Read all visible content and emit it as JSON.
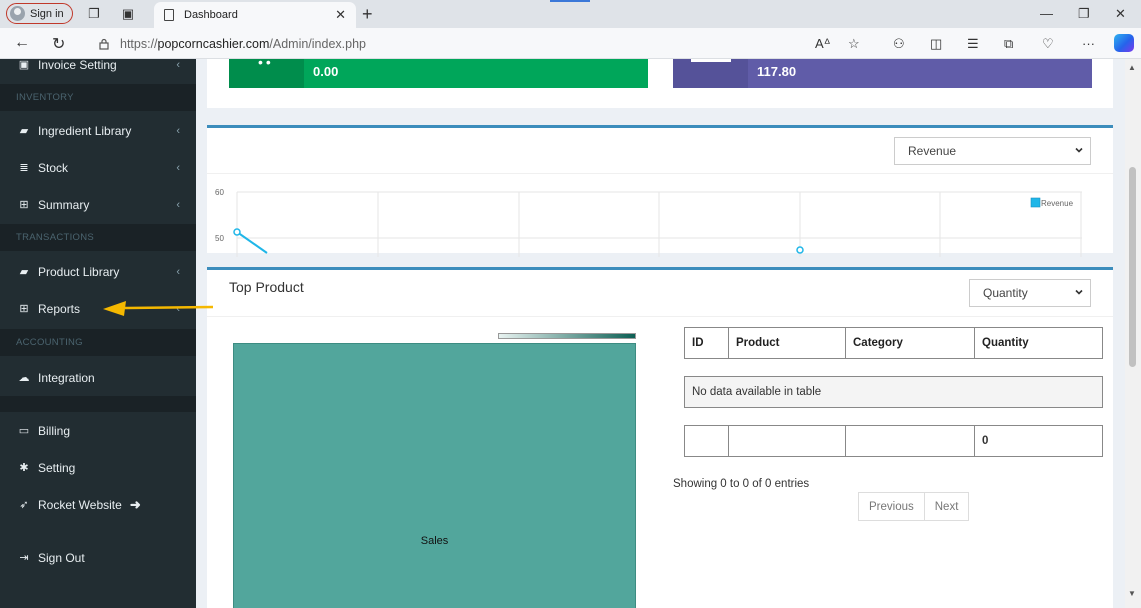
{
  "browser": {
    "signin_label": "Sign in",
    "tab_title": "Dashboard",
    "url_prefix": "https://",
    "url_domain": "popcorncashier.com",
    "url_path": "/Admin/index.php"
  },
  "sidebar": {
    "items": [
      {
        "id": "invoice-setting",
        "label": "Invoice Setting",
        "icon": "invoice-icon",
        "chevron": true
      },
      {
        "id": "ingredient-library",
        "label": "Ingredient Library",
        "icon": "book-icon",
        "chevron": true
      },
      {
        "id": "stock",
        "label": "Stock",
        "icon": "database-icon",
        "chevron": true
      },
      {
        "id": "summary",
        "label": "Summary",
        "icon": "table-icon",
        "chevron": true
      },
      {
        "id": "product-library",
        "label": "Product Library",
        "icon": "book-icon",
        "chevron": true
      },
      {
        "id": "reports",
        "label": "Reports",
        "icon": "table-icon",
        "chevron": true
      },
      {
        "id": "integration",
        "label": "Integration",
        "icon": "cloud-icon",
        "chevron": false
      },
      {
        "id": "billing",
        "label": "Billing",
        "icon": "credit-card-icon",
        "chevron": false
      },
      {
        "id": "setting",
        "label": "Setting",
        "icon": "gear-icon",
        "chevron": false
      },
      {
        "id": "rocket-website",
        "label": "Rocket Website",
        "icon": "rocket-icon",
        "chevron": false,
        "suffix_icon": "arrow-right-icon"
      },
      {
        "id": "sign-out",
        "label": "Sign Out",
        "icon": "sign-out-icon",
        "chevron": false
      }
    ],
    "headers": {
      "inventory": "INVENTORY",
      "transactions": "TRANSACTIONS",
      "accounting": "ACCOUNTING"
    }
  },
  "stats": {
    "green_value": "0.00",
    "purple_value": "117.80"
  },
  "revenue_panel": {
    "dropdown_value": "Revenue",
    "chart_data": {
      "type": "line",
      "series": [
        {
          "name": "Revenue"
        }
      ],
      "y_ticks_visible": [
        "60",
        "50"
      ],
      "legend_placement": "top-right",
      "grid": true
    }
  },
  "top_product": {
    "title": "Top Product",
    "dropdown_value": "Quantity",
    "treemap_label": "Sales",
    "table": {
      "headers": [
        "ID",
        "Product",
        "Category",
        "Quantity"
      ],
      "empty_message": "No data available in table",
      "footer_row": [
        "",
        "",
        "",
        "0"
      ]
    },
    "info_text": "Showing 0 to 0 of 0 entries",
    "pager": {
      "previous": "Previous",
      "next": "Next"
    }
  },
  "colors": {
    "sidebar_bg": "#222d32",
    "green": "#00a65a",
    "purple": "#605ca8",
    "accent_blue": "#3c8dbc",
    "treemap": "#52a69c",
    "arrow": "#f5b800"
  }
}
